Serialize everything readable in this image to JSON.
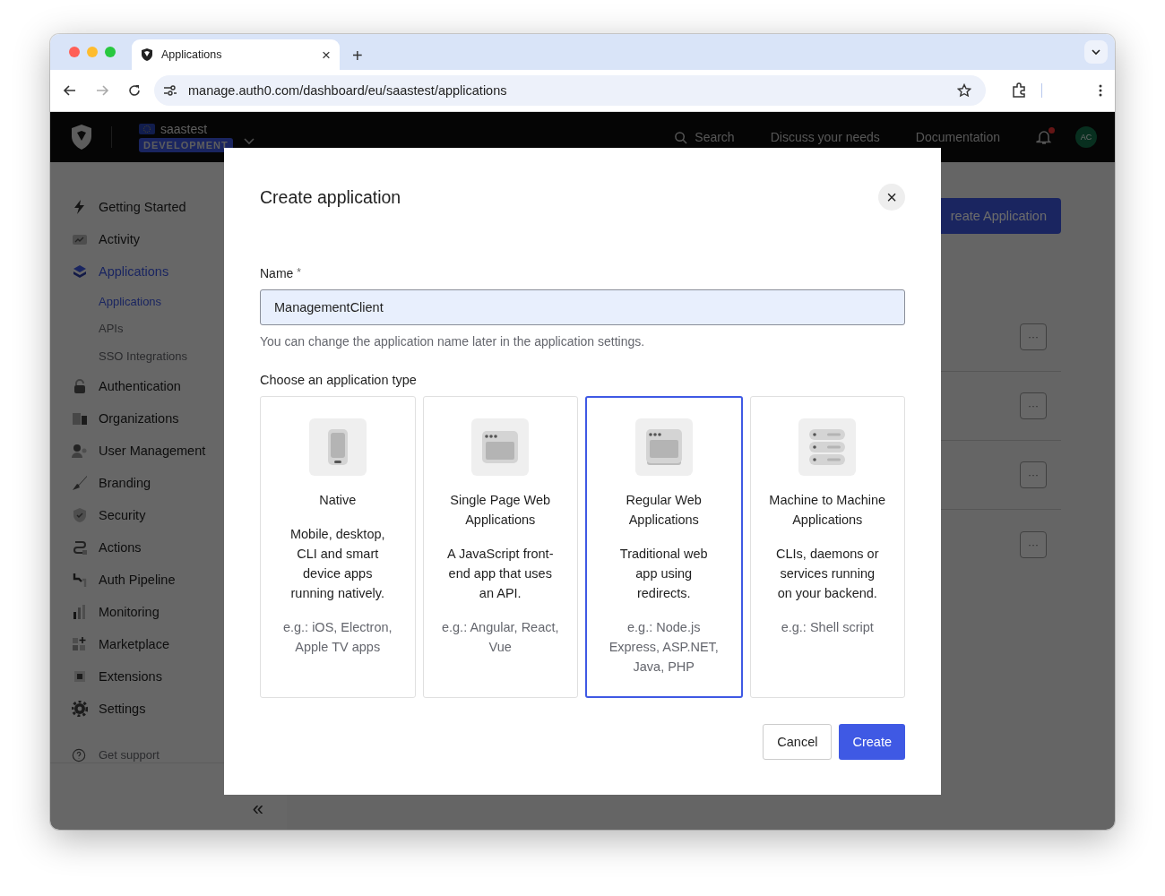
{
  "browser": {
    "tab_title": "Applications",
    "tab_close": "×",
    "new_tab": "+",
    "url": "manage.auth0.com/dashboard/eu/saastest/applications"
  },
  "header": {
    "tenant": "saastest",
    "environment": "DEVELOPMENT",
    "search": "Search",
    "links": [
      "Discuss your needs",
      "Documentation"
    ],
    "notification": true,
    "avatar": "AC"
  },
  "sidebar": {
    "items": [
      {
        "label": "Getting Started",
        "selected": false
      },
      {
        "label": "Activity",
        "selected": false
      },
      {
        "label": "Applications",
        "selected": true,
        "children": [
          {
            "label": "Applications",
            "selected": true
          },
          {
            "label": "APIs",
            "selected": false
          },
          {
            "label": "SSO Integrations",
            "selected": false
          }
        ]
      },
      {
        "label": "Authentication",
        "selected": false
      },
      {
        "label": "Organizations",
        "selected": false
      },
      {
        "label": "User Management",
        "selected": false
      },
      {
        "label": "Branding",
        "selected": false
      },
      {
        "label": "Security",
        "selected": false
      },
      {
        "label": "Actions",
        "selected": false
      },
      {
        "label": "Auth Pipeline",
        "selected": false
      },
      {
        "label": "Monitoring",
        "selected": false
      },
      {
        "label": "Marketplace",
        "selected": false
      },
      {
        "label": "Extensions",
        "selected": false
      },
      {
        "label": "Settings",
        "selected": false
      }
    ],
    "support": "Get support",
    "collapse": "«"
  },
  "main": {
    "create_button": "reate Application",
    "rows": [
      {
        "menu": "···"
      },
      {
        "menu": "···"
      },
      {
        "menu": "···"
      },
      {
        "menu": "···"
      }
    ]
  },
  "dialog": {
    "title": "Create application",
    "close": "×",
    "name_label": "Name",
    "required_mark": "*",
    "name_value": "ManagementClient",
    "name_help": "You can change the application name later in the application settings.",
    "type_label": "Choose an application type",
    "types": [
      {
        "title": "Native",
        "description": "Mobile, desktop, CLI and smart device apps running natively.",
        "examples": "e.g.: iOS, Electron, Apple TV apps",
        "selected": false
      },
      {
        "title": "Single Page Web Applications",
        "description": "A JavaScript front-end app that uses an API.",
        "examples": "e.g.: Angular, React, Vue",
        "selected": false
      },
      {
        "title": "Regular Web Applications",
        "description": "Traditional web app using redirects.",
        "examples": "e.g.: Node.js Express, ASP.NET, Java, PHP",
        "selected": true
      },
      {
        "title": "Machine to Machine Applications",
        "description": "CLIs, daemons or services running on your backend.",
        "examples": "e.g.: Shell script",
        "selected": false
      }
    ],
    "cancel": "Cancel",
    "create": "Create"
  }
}
